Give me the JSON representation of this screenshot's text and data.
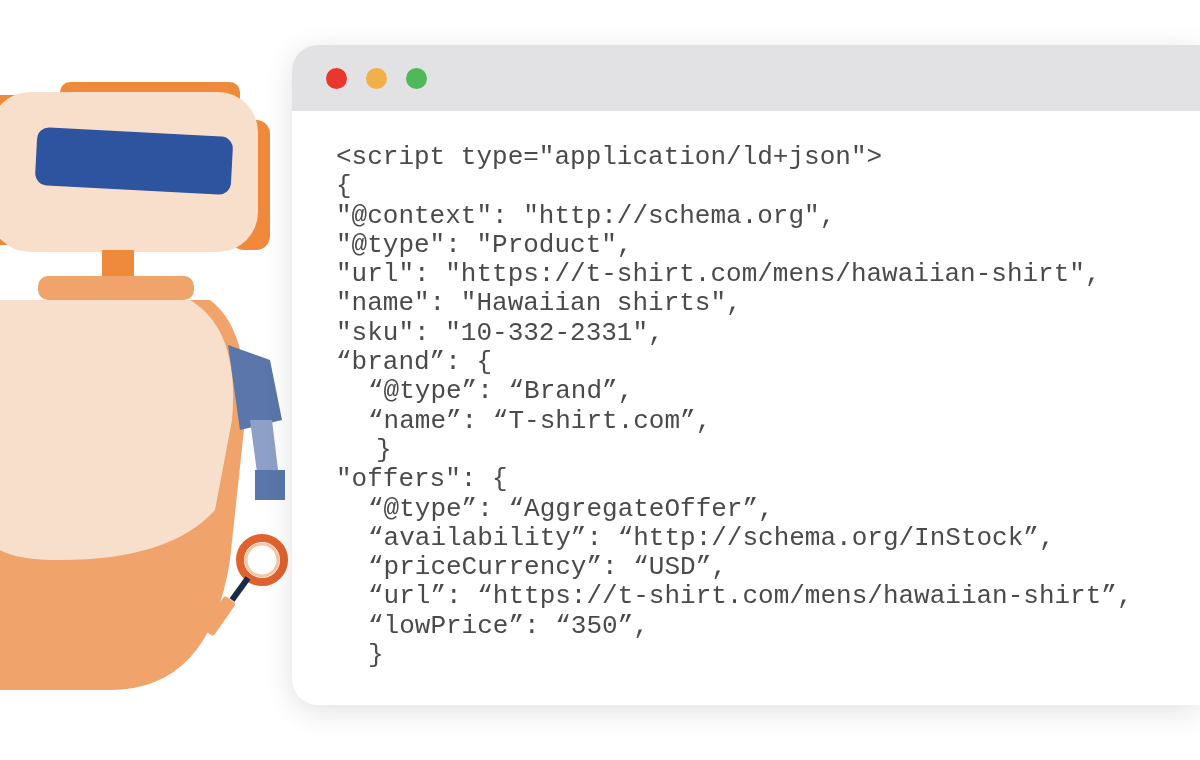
{
  "window": {
    "controls": [
      {
        "color": "#e8372c"
      },
      {
        "color": "#f0b04a"
      },
      {
        "color": "#4fb85a"
      }
    ]
  },
  "code_lines": [
    {
      "text": "<script type=\"application/ld+json\">",
      "kind": "top"
    },
    {
      "text": "{",
      "kind": "top"
    },
    {
      "text": "\"@context\": \"http://schema.org\",",
      "kind": "top"
    },
    {
      "text": "\"@type\": \"Product\",",
      "kind": "top"
    },
    {
      "text": "\"url\": \"https://t-shirt.com/mens/hawaiian-shirt\",",
      "kind": "top"
    },
    {
      "text": "\"name\": \"Hawaiian shirts\",",
      "kind": "top"
    },
    {
      "text": "\"sku\": \"10-332-2331\",",
      "kind": "top"
    },
    {
      "text": "“brand”: {",
      "kind": "top"
    },
    {
      "text": "“@type”: “Brand”,",
      "kind": "nested"
    },
    {
      "text": "“name”: “T-shirt.com”,",
      "kind": "nested"
    },
    {
      "text": "}",
      "kind": "closing"
    },
    {
      "text": "\"offers\": {",
      "kind": "top"
    },
    {
      "text": "“@type”: “AggregateOffer”,",
      "kind": "nested"
    },
    {
      "text": "“availability”: “http://schema.org/InStock”,",
      "kind": "nested"
    },
    {
      "text": "“priceCurrency”: “USD”,",
      "kind": "nested"
    },
    {
      "text": "“url”: “https://t-shirt.com/mens/hawaiian-shirt”,",
      "kind": "nested"
    },
    {
      "text": "“lowPrice”: “350”,",
      "kind": "nested"
    },
    {
      "text": "}",
      "kind": "nested"
    }
  ]
}
